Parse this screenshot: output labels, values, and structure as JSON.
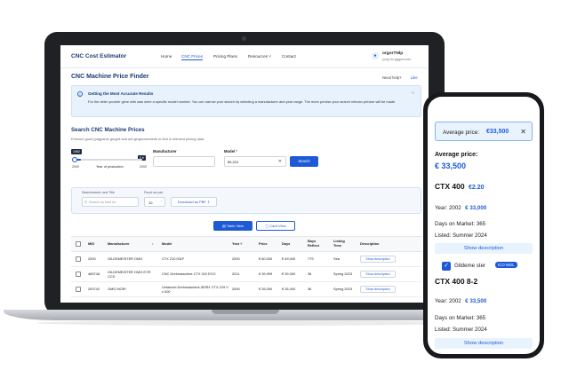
{
  "nav": {
    "brand": "CNC Cost Estimator",
    "links": [
      "Home",
      "CNC Prices",
      "Pricing Plans",
      "Resources ˅",
      "Contact"
    ],
    "active_index": 1,
    "user_name": "orgorTNlp",
    "user_email": "yuug fro.jiggpot.com"
  },
  "page": {
    "title": "CNC Machine Price Finder",
    "help_label": "Need help?",
    "help_link": "Like"
  },
  "info": {
    "title": "Getting the Most Accurate Results",
    "body": "For the deter youreer geve with was were a specific model number. You can narrow your search by selecting a manufacturer and year range. The more precise your search relevan precise will be made."
  },
  "search": {
    "title": "Search CNC Machine Prices",
    "subtitle": "Enenum good (pagpants grugell and ant gingevmenterts to find lo relevant pricing data.",
    "year_from_chip": "1982",
    "year_to_chip": "2 è",
    "year_min": "2000",
    "year_label": "Year of production",
    "year_max": "2000",
    "year_range_fraction": 0.12,
    "manufacturer_label": "Manufacturer",
    "model_label": "Model",
    "model_required": "*",
    "model_value": "€6,310",
    "clear_icon": "✕",
    "button": "Search"
  },
  "filters": {
    "search_label": "Searchsearch, and Title",
    "search_placeholder": "Search by field lot",
    "per_page_label": "Fsout cor pan",
    "per_page_value": "10",
    "pdf_button": "Download as PBF ⇩"
  },
  "views": {
    "table": "▤ Table View",
    "card": "▢ Card View"
  },
  "table": {
    "headers": [
      "MID",
      "Manufacturer",
      "↕",
      "Model",
      "Year ˅",
      "Price",
      "Days",
      "Bays Reflect",
      "Listing Time",
      "Description"
    ],
    "rows": [
      {
        "mid": "2000",
        "manufacturer": "GILDEMEISTER OMG",
        "model": "CTX 210 001F",
        "year": "2000",
        "price": "€ 60,000",
        "days": "€ 49,000",
        "bays": "779",
        "listing": "Sea",
        "desc": "Show description"
      },
      {
        "mid": "465748",
        "manufacturer": "GILDEMEISTER OMG EYR CCD",
        "model": "CNC Drehmaschine CTX 310 ECO",
        "year": "2011",
        "price": "€ 39,999",
        "days": "€ 39,300",
        "bays": "36",
        "listing": "Spring 2023",
        "desc": "Show description"
      },
      {
        "mid": "200742",
        "manufacturer": "OMG MORI",
        "model": "Unlanced Drehmaschine-3EIR1 CTX 219 V x 000",
        "year": "2000",
        "price": "€ 26,000",
        "days": "€ 26,400",
        "bays": "36",
        "listing": "Spring 2023",
        "desc": "Show description"
      }
    ]
  },
  "mobile": {
    "chip_label": "Average price:",
    "chip_value": "€33,500",
    "chip_close": "✕",
    "card1": {
      "avg_label": "Average price:",
      "avg_value": "€ 33,500",
      "model": "CTX 400",
      "model_sub": "€2.20",
      "year_label": "Year: 2002",
      "year_price": "€ 33,000",
      "days": "Days on Market: 365",
      "listed": "Listed: Summer 2024",
      "button": "Show description"
    },
    "card2": {
      "manufacturer": "Gildeme ster",
      "badge": "ICO MOL",
      "model": "CTX 400 8-2",
      "year_label": "Year: 2002",
      "year_price": "€ 33,500",
      "days": "Days on Market: 365",
      "listed": "Listed: Summer 2024",
      "button": "Show description"
    }
  },
  "colors": {
    "primary": "#1e5ad6",
    "brand": "#1a3a73",
    "info_bg": "#e8f2fd"
  }
}
